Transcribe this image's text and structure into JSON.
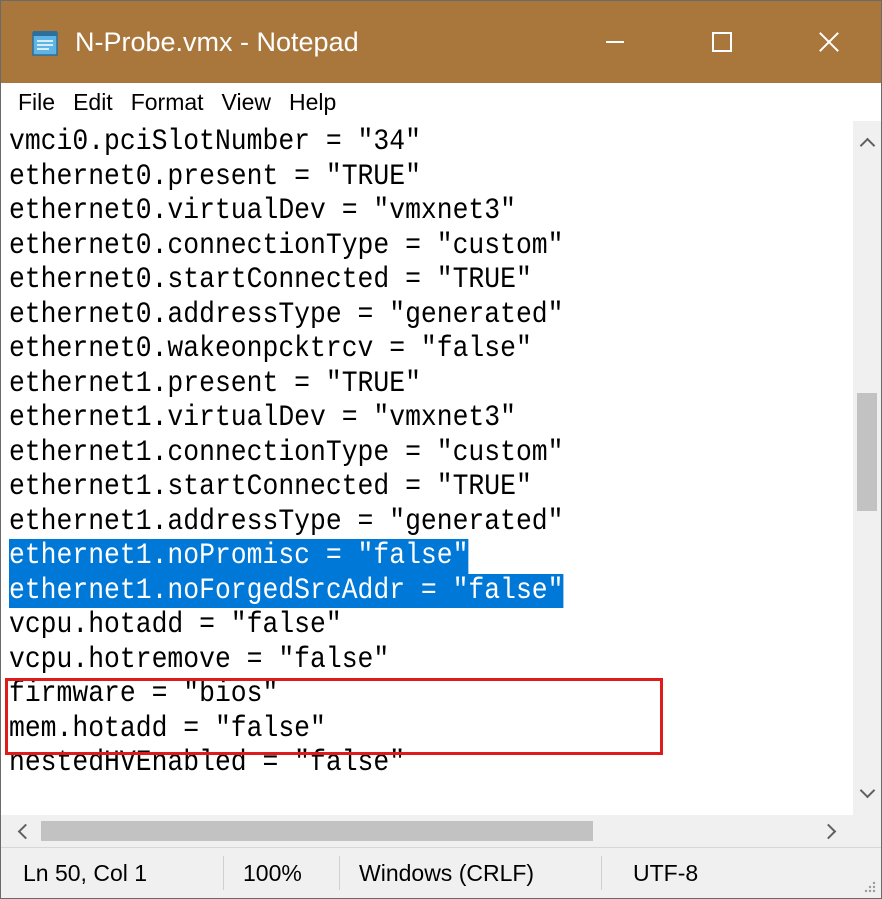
{
  "window": {
    "title": "N-Probe.vmx - Notepad",
    "accent_color": "#a9763c",
    "controls": [
      "minimize-icon",
      "maximize-icon",
      "close-icon"
    ]
  },
  "menu": [
    "File",
    "Edit",
    "Format",
    "View",
    "Help"
  ],
  "editor": {
    "lines": [
      "vmci0.pciSlotNumber = \"34\"",
      "ethernet0.present = \"TRUE\"",
      "ethernet0.virtualDev = \"vmxnet3\"",
      "ethernet0.connectionType = \"custom\"",
      "ethernet0.startConnected = \"TRUE\"",
      "ethernet0.addressType = \"generated\"",
      "ethernet0.wakeonpcktrcv = \"false\"",
      "ethernet1.present = \"TRUE\"",
      "ethernet1.virtualDev = \"vmxnet3\"",
      "ethernet1.connectionType = \"custom\"",
      "ethernet1.startConnected = \"TRUE\"",
      "ethernet1.addressType = \"generated\"",
      "ethernet1.noPromisc = \"false\"",
      "ethernet1.noForgedSrcAddr = \"false\"",
      "vcpu.hotadd = \"false\"",
      "vcpu.hotremove = \"false\"",
      "firmware = \"bios\"",
      "mem.hotadd = \"false\"",
      "nestedHVEnabled = \"false\""
    ],
    "selected_lines": [
      12,
      13
    ],
    "selection_color": "#0078d7",
    "highlight_border_color": "#e01b1b"
  },
  "status": {
    "position": "Ln 50, Col 1",
    "zoom": "100%",
    "line_ending": "Windows (CRLF)",
    "encoding": "UTF-8"
  }
}
